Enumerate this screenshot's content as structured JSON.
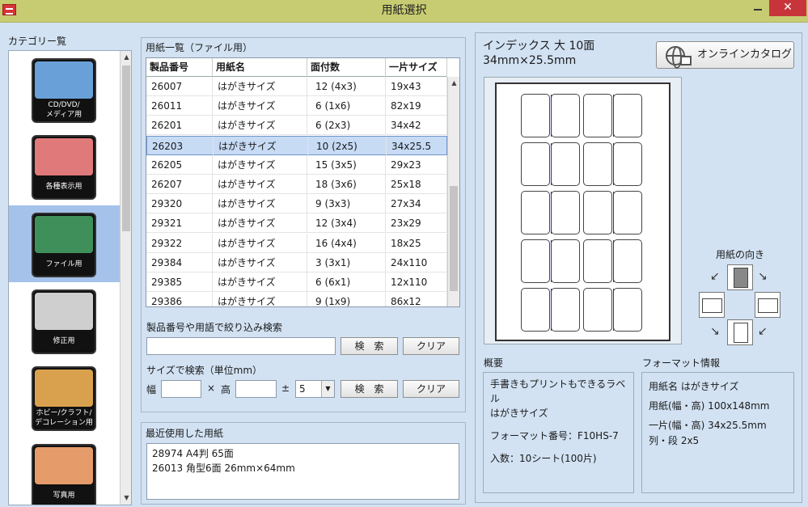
{
  "window": {
    "title": "用紙選択",
    "min_label": "",
    "close_label": "✕"
  },
  "category": {
    "title": "カテゴリー覧",
    "items": [
      {
        "label": "CD/DVD/\nメディア用",
        "thumb": "#6aa0d8"
      },
      {
        "label": "各種表示用",
        "thumb": "#e07a7a"
      },
      {
        "label": "ファイル用",
        "thumb": "#3f8f5a"
      },
      {
        "label": "修正用",
        "thumb": "#cfcfcf"
      },
      {
        "label": "ホビー/クラフト/\nデコレーション用",
        "thumb": "#d9a14e"
      },
      {
        "label": "写真用",
        "thumb": "#e59b6a"
      }
    ],
    "selected": 2
  },
  "paper_list": {
    "group_title": "用紙一覧（ファイル用）",
    "columns": [
      "製品番号",
      "用紙名",
      "面付数",
      "一片サイズ"
    ],
    "rows": [
      [
        "26007",
        "はがきサイズ",
        "12 (4x3)",
        "19x43"
      ],
      [
        "26011",
        "はがきサイズ",
        "6 (1x6)",
        "82x19"
      ],
      [
        "26201",
        "はがきサイズ",
        "6 (2x3)",
        "34x42"
      ],
      [
        "26203",
        "はがきサイズ",
        "10 (2x5)",
        "34x25.5"
      ],
      [
        "26205",
        "はがきサイズ",
        "15 (3x5)",
        "29x23"
      ],
      [
        "26207",
        "はがきサイズ",
        "18 (3x6)",
        "25x18"
      ],
      [
        "29320",
        "はがきサイズ",
        "9 (3x3)",
        "27x34"
      ],
      [
        "29321",
        "はがきサイズ",
        "12 (3x4)",
        "23x29"
      ],
      [
        "29322",
        "はがきサイズ",
        "16 (4x4)",
        "18x25"
      ],
      [
        "29384",
        "はがきサイズ",
        "3 (3x1)",
        "24x110"
      ],
      [
        "29385",
        "はがきサイズ",
        "6 (6x1)",
        "12x110"
      ],
      [
        "29386",
        "はがきサイズ",
        "9 (1x9)",
        "86x12"
      ]
    ],
    "selected_row": 3
  },
  "filter": {
    "label": "製品番号や用語で絞り込み検索",
    "value": "",
    "search_label": "検　索",
    "clear_label": "クリア"
  },
  "size_search": {
    "label": "サイズで検索（単位mm）",
    "width_label": "幅",
    "times": "×",
    "height_label": "高",
    "plusminus": "±",
    "tolerance": "5",
    "search_label": "検　索",
    "clear_label": "クリア"
  },
  "recent": {
    "group_title": "最近使用した用紙",
    "items": [
      "28974 A4判 65面",
      "26013 角型6面 26mm×64mm"
    ]
  },
  "preview": {
    "title_line1": "インデックス 大 10面",
    "title_line2": "34mm×25.5mm",
    "catalog_label": "オンラインカタログ",
    "orientation_title": "用紙の向き",
    "grid": {
      "cols": 4,
      "rows": 5
    }
  },
  "summary": {
    "title": "概要",
    "lines": [
      "手書きもプリントもできるラベル",
      "はがきサイズ",
      "",
      "フォーマット番号：F10HS-7",
      "",
      "入数：10シート(100片)"
    ]
  },
  "format": {
    "title": "フォーマット情報",
    "lines": [
      "用紙名 はがきサイズ",
      "用紙(幅・高) 100x148mm",
      "一片(幅・高) 34x25.5mm",
      "列・段 2x5"
    ]
  }
}
